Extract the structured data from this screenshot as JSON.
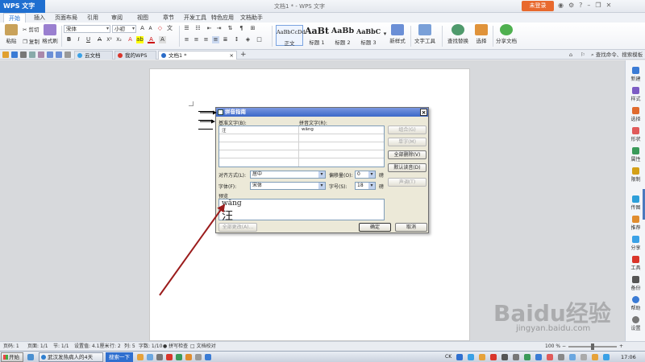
{
  "window": {
    "app_button": "WPS 文字",
    "title": "文档1 * - WPS 文字",
    "login_button": "未登录"
  },
  "menu": [
    "开始",
    "插入",
    "页面布局",
    "引用",
    "审阅",
    "视图",
    "章节",
    "开发工具",
    "特色应用",
    "文档助手"
  ],
  "ribbon": {
    "paste": "粘贴",
    "cut": "剪切",
    "copy": "复制",
    "format_painter": "格式刷",
    "font_name": "宋体",
    "font_size": "小初",
    "styles": [
      {
        "sample": "AaBbCcDd",
        "label": "正文"
      },
      {
        "sample": "AaBt",
        "label": "标题 1"
      },
      {
        "sample": "AaBb",
        "label": "标题 2"
      },
      {
        "sample": "AaBbC",
        "label": "标题 3"
      }
    ],
    "new_style": "新样式",
    "text_tools": "文字工具",
    "find_replace": "查找替换",
    "select": "选择",
    "share_doc": "分享文档"
  },
  "doc_tabs": [
    {
      "label": "云文档",
      "color": "#3aa1e6"
    },
    {
      "label": "我的WPS",
      "color": "#d9352b"
    },
    {
      "label": "文档1 *",
      "color": "#2b6cc8"
    }
  ],
  "search_hint": "查找命令、搜索模板",
  "dialog": {
    "title": "拼音指南",
    "base_text_label": "基准文字(B):",
    "ruby_text_label": "拼音文字(R):",
    "base_text_value": "汪",
    "ruby_text_value": "wāng",
    "buttons_right": [
      {
        "label": "组合(G)",
        "enabled": false
      },
      {
        "label": "单字(M)",
        "enabled": false
      },
      {
        "label": "全部删除(V)",
        "enabled": true
      },
      {
        "label": "默认读音(D)",
        "enabled": true
      },
      {
        "label": "声调(T)",
        "enabled": false
      }
    ],
    "align_label": "对齐方式(L):",
    "align_value": "居中",
    "offset_label": "偏移量(O):",
    "offset_value": "0",
    "offset_unit": "磅",
    "font_label": "字体(F):",
    "font_value": "宋体",
    "size_label": "字号(S):",
    "size_value": "18",
    "size_unit": "磅",
    "preview_label": "预览",
    "preview_pinyin": "wāng",
    "preview_char": "汪",
    "change_all": "全部更改(A)...",
    "ok": "确定",
    "cancel": "取消"
  },
  "sidebar": [
    {
      "label": "新建",
      "color": "#3a7bd5"
    },
    {
      "label": "样式",
      "color": "#7c5cc4"
    },
    {
      "label": "选择",
      "color": "#e06b2e"
    },
    {
      "label": "形状",
      "color": "#e05a5a"
    },
    {
      "label": "属性",
      "color": "#3a9a5a"
    },
    {
      "label": "限制",
      "color": "#d4a017"
    },
    {
      "label": "传图",
      "color": "#2e9fd9"
    },
    {
      "label": "推荐",
      "color": "#e08c2e"
    },
    {
      "label": "分享",
      "color": "#3aa1e6"
    },
    {
      "label": "工具",
      "color": "#d9352b"
    },
    {
      "label": "备份",
      "color": "#555555"
    },
    {
      "label": "帮助",
      "color": "#3a7bd5"
    },
    {
      "label": "设置",
      "color": "#777777"
    }
  ],
  "status": {
    "page_num": "页码: 1",
    "pages": "页面: 1/1",
    "section": "节: 1/1",
    "setting": "设置值: 4.1厘米",
    "row": "行: 2",
    "col": "列: 5",
    "words": "字数: 1/10",
    "spell": "拼写检查",
    "proof": "文档校对",
    "zoom": "100 %"
  },
  "taskbar": {
    "start": "开始",
    "news": "武汉发热病人的4天",
    "search": "搜索一下",
    "clock": "17:06"
  },
  "watermark": "jingyan.baidu.com",
  "watermark_logo": "Baidu经验"
}
